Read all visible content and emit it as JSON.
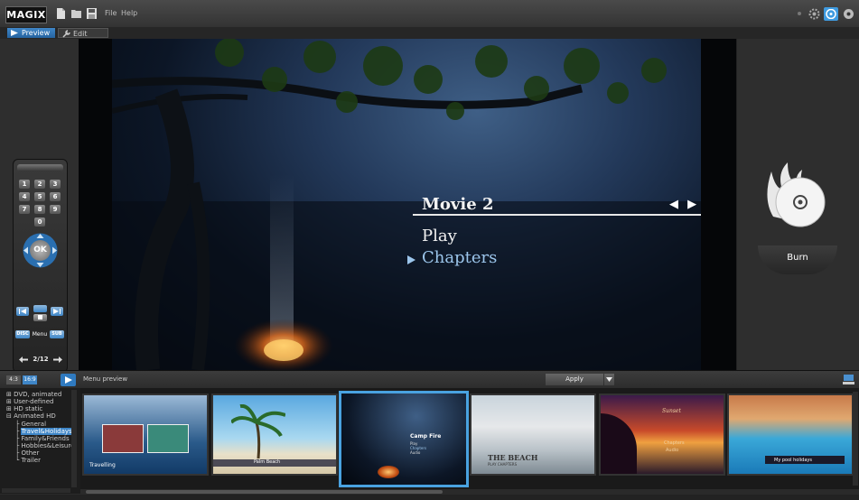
{
  "app": {
    "logo": "MAGIX",
    "menu": [
      "File",
      "Help"
    ]
  },
  "tabs": {
    "preview": "Preview",
    "edit": "Edit"
  },
  "remote": {
    "keys": [
      "1",
      "2",
      "3",
      "4",
      "5",
      "6",
      "7",
      "8",
      "9",
      "0"
    ],
    "ok": "OK",
    "disc": "DISC",
    "menu": "Menu",
    "sub": "SUB",
    "page": "2/12"
  },
  "video_menu": {
    "title": "Movie 2",
    "nav": "◀ ▶",
    "items": [
      "Play",
      "Chapters"
    ],
    "selected_index": 1
  },
  "burn": {
    "label": "Burn"
  },
  "bottom": {
    "aspect_43": "4:3",
    "aspect_169": "16:9",
    "menu_preview": "Menu preview",
    "apply": "Apply"
  },
  "tree": {
    "items": [
      "DVD, animated",
      "User-defined",
      "HD static",
      "Animated HD"
    ],
    "sub_items": [
      "General",
      "Travel&Holidays",
      "Family&Friends",
      "Hobbies&Leisure",
      "Other",
      "Trailer"
    ],
    "selected_sub": "Travel&Holidays"
  },
  "thumbnails": [
    {
      "label": "Travelling"
    },
    {
      "label": "Palm Beach"
    },
    {
      "label": "Camp Fire",
      "items": [
        "Play",
        "Chapters",
        "Audio"
      ],
      "selected": true
    },
    {
      "label": "THE BEACH",
      "sub": "PLAY   CHAPTERS"
    },
    {
      "label": "Sunset",
      "items": [
        "Chapters",
        "Audio"
      ]
    },
    {
      "label": "My pool holidays"
    }
  ],
  "colors": {
    "accent": "#3f86c7",
    "selection": "#49a2e0",
    "burn_flame": "#e8e8e8"
  }
}
